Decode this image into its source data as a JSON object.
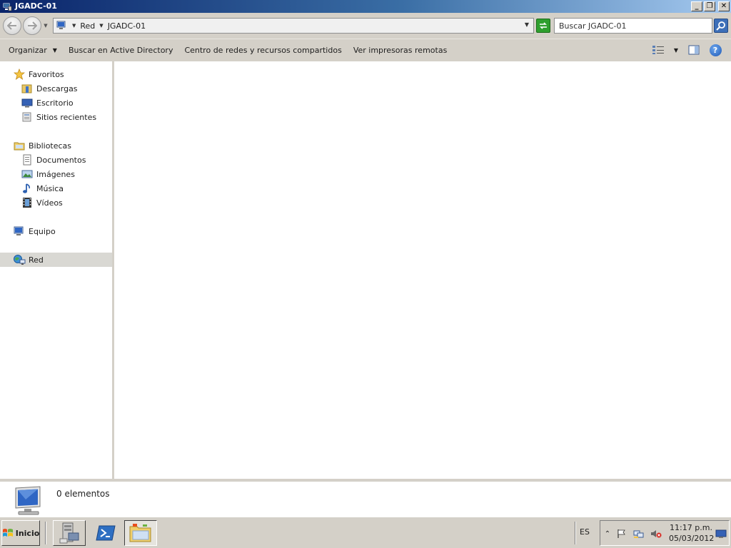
{
  "window": {
    "title": "JGADC-01"
  },
  "window_buttons": {
    "minimize": "_",
    "restore": "❐",
    "close": "✕"
  },
  "address": {
    "segments": [
      "Red",
      "JGADC-01"
    ]
  },
  "search": {
    "placeholder": "Buscar JGADC-01"
  },
  "commands": {
    "organize": "Organizar",
    "ad_search": "Buscar en Active Directory",
    "network_center": "Centro de redes y recursos compartidos",
    "remote_printers": "Ver impresoras remotas"
  },
  "nav": {
    "favorites": "Favoritos",
    "downloads": "Descargas",
    "desktop": "Escritorio",
    "recent": "Sitios recientes",
    "libraries": "Bibliotecas",
    "documents": "Documentos",
    "pictures": "Imágenes",
    "music": "Música",
    "videos": "Vídeos",
    "computer": "Equipo",
    "network": "Red"
  },
  "details": {
    "count": "0 elementos"
  },
  "taskbar": {
    "start": "Inicio",
    "language": "ES",
    "time": "11:17 p.m.",
    "date": "05/03/2012"
  },
  "colors": {
    "titlebar_start": "#0a246a",
    "titlebar_end": "#a6caf0",
    "chrome": "#d4d0c8",
    "selected_nav": "#d9d8d3"
  },
  "icons": {
    "app": "network-computer-icon",
    "back": "back-arrow-icon",
    "forward": "forward-arrow-icon",
    "refresh": "refresh-icon",
    "search": "magnifier-icon",
    "help": "help-icon"
  }
}
